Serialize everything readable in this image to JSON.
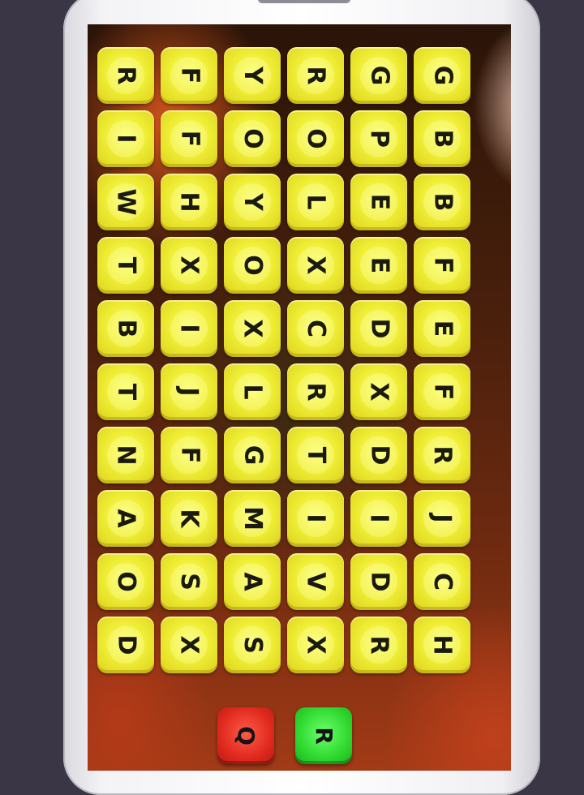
{
  "rows": [
    [
      "R",
      "F",
      "Y",
      "R",
      "G",
      "G"
    ],
    [
      "I",
      "F",
      "O",
      "O",
      "P",
      "B"
    ],
    [
      "W",
      "H",
      "Y",
      "L",
      "E",
      "B"
    ],
    [
      "T",
      "X",
      "O",
      "X",
      "E",
      "F"
    ],
    [
      "B",
      "I",
      "X",
      "C",
      "D",
      "E"
    ],
    [
      "T",
      "J",
      "L",
      "R",
      "X",
      "F"
    ],
    [
      "N",
      "F",
      "G",
      "T",
      "D",
      "R"
    ],
    [
      "A",
      "K",
      "M",
      "I",
      "I",
      "J"
    ],
    [
      "O",
      "S",
      "A",
      "V",
      "D",
      "C"
    ],
    [
      "D",
      "X",
      "S",
      "X",
      "R",
      "H"
    ]
  ],
  "buttons": {
    "q_label": "Q",
    "r_label": "R"
  },
  "colors": {
    "tile": "#f0ee36",
    "q_button": "#e02a1e",
    "r_button": "#2fd92f"
  }
}
